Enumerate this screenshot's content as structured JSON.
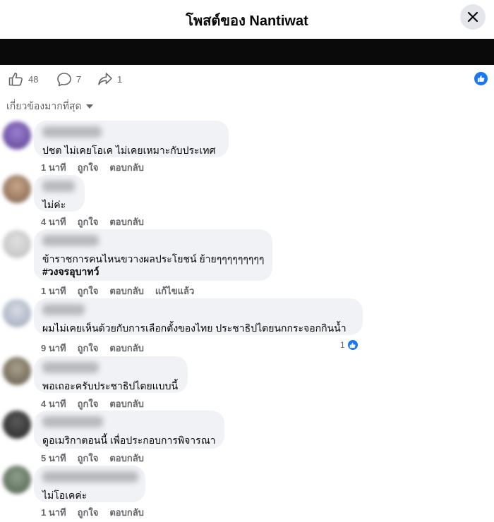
{
  "header": {
    "title": "โพสต์ของ Nantiwat"
  },
  "stats": {
    "likes": "48",
    "comments": "7",
    "shares": "1"
  },
  "sort": {
    "label": "เกี่ยวข้องมากที่สุด"
  },
  "actions": {
    "like": "ถูกใจ",
    "reply": "ตอบกลับ",
    "edited": "แก้ไขแล้ว"
  },
  "comments": [
    {
      "time": "1 นาที",
      "text": "ปชต ไม่เคยโอเค ไม่เคยเหมาะกับประเทศ"
    },
    {
      "time": "4 นาที",
      "text": "ไม่ค่ะ"
    },
    {
      "time": "1 นาที",
      "text": "ข้าราชการคนไหนขวางผลประโยชน์ ย้ายๆๆๆๆๆๆๆๆๆ",
      "text2": "#วงจรอุบาทว์"
    },
    {
      "time": "9 นาที",
      "text": "ผมไม่เคยเห็นด้วยกับการเลือกตั้งของไทย ประชาธิปไตยนกกระจอกกินน้ำ",
      "reaction_count": "1"
    },
    {
      "time": "4 นาที",
      "text": "พอเถอะครับประชาธิปไตยแบบนี้"
    },
    {
      "time": "5 นาที",
      "text": "ดูอเมริกาตอนนี้ เพื่อประกอบการพิจารณา"
    },
    {
      "time": "1 นาที",
      "text": "ไม่โอเคค่ะ"
    }
  ],
  "icons": {
    "like": "thumbs-up-icon",
    "comment": "speech-bubble-icon",
    "share": "share-arrow-icon",
    "close": "close-icon"
  },
  "colors": {
    "accent": "#1877f2",
    "bubble": "#f0f2f5",
    "muted": "#65676b"
  }
}
